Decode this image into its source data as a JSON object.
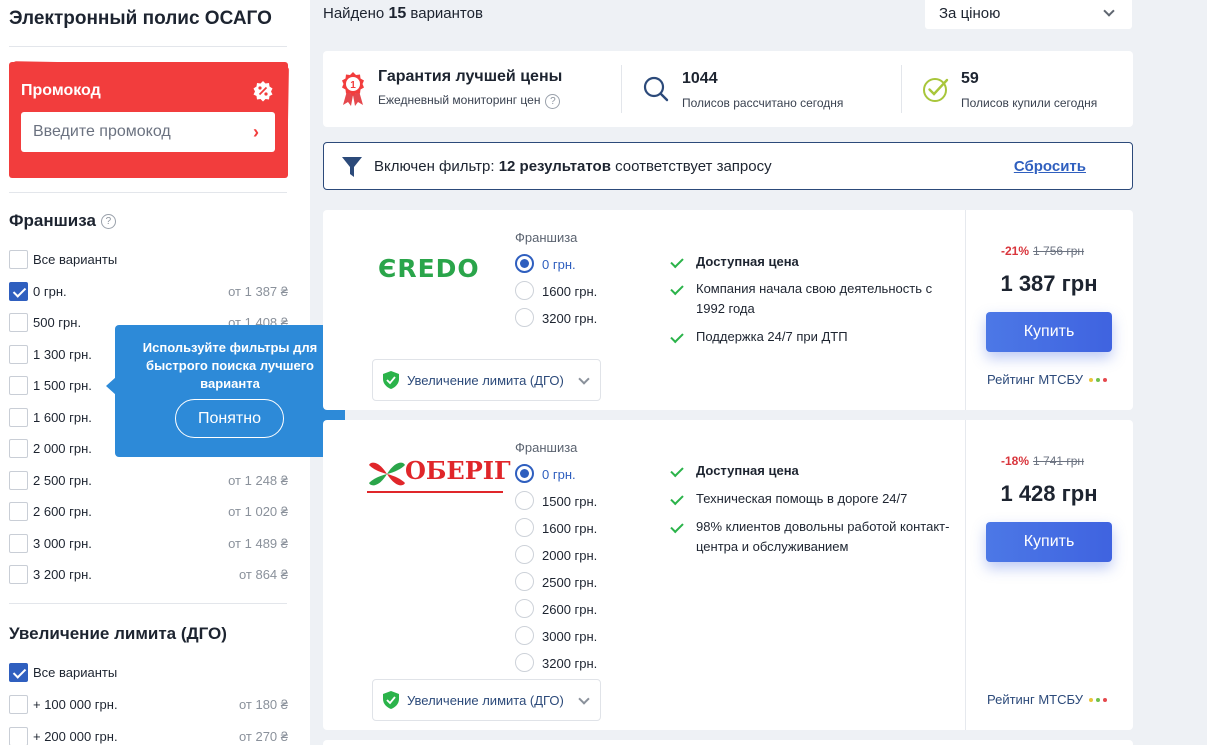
{
  "sidebar": {
    "title": "Электронный полис ОСАГО",
    "promo": {
      "title": "Промокод",
      "placeholder": "Введите промокод"
    },
    "franchise": {
      "title": "Франшиза",
      "items": [
        {
          "label": "Все варианты",
          "price": "",
          "checked": false
        },
        {
          "label": "0 грн.",
          "price": "от 1 387 ₴",
          "checked": true
        },
        {
          "label": "500 грн.",
          "price": "от 1 408 ₴",
          "checked": false
        },
        {
          "label": "1 300 грн.",
          "price": "",
          "checked": false
        },
        {
          "label": "1 500 грн.",
          "price": "",
          "checked": false
        },
        {
          "label": "1 600 грн.",
          "price": "",
          "checked": false
        },
        {
          "label": "2 000 грн.",
          "price": "",
          "checked": false
        },
        {
          "label": "2 500 грн.",
          "price": "от 1 248 ₴",
          "checked": false
        },
        {
          "label": "2 600 грн.",
          "price": "от 1 020 ₴",
          "checked": false
        },
        {
          "label": "3 000 грн.",
          "price": "от 1 489 ₴",
          "checked": false
        },
        {
          "label": "3 200 грн.",
          "price": "от 864 ₴",
          "checked": false
        }
      ]
    },
    "dgo": {
      "title": "Увеличение лимита (ДГО)",
      "items": [
        {
          "label": "Все варианты",
          "price": "",
          "checked": true
        },
        {
          "label": "+ 100 000 грн.",
          "price": "от 180 ₴",
          "checked": false
        },
        {
          "label": "+ 200 000 грн.",
          "price": "от 270 ₴",
          "checked": false
        }
      ]
    }
  },
  "tooltip": {
    "text": "Используйте фильтры для быстрого поиска лучшего варианта",
    "button": "Понятно",
    "close": "×"
  },
  "header": {
    "found_prefix": "Найдено",
    "found_count": "15",
    "found_suffix": "вариантов",
    "sort_label": "За ціною"
  },
  "stats": {
    "guarantee_title": "Гарантия лучшей цены",
    "guarantee_sub": "Ежедневный мониторинг цен",
    "calc_count": "1044",
    "calc_sub": "Полисов рассчитано сегодня",
    "bought_count": "59",
    "bought_sub": "Полисов купили сегодня",
    "badge_number": "1"
  },
  "filter": {
    "prefix": "Включен фильтр:",
    "results": "12 результатов",
    "suffix": "соответствует запросу",
    "reset": "Сбросить"
  },
  "offers": [
    {
      "logo_text": "ЄREDO",
      "franchise_title": "Франшиза",
      "franchise_options": [
        "0 грн.",
        "1600 грн.",
        "3200 грн."
      ],
      "dgo_label": "Увеличение лимита (ДГО)",
      "features": [
        "Доступная цена",
        "Компания начала свою деятельность с 1992 года",
        "Поддержка 24/7 при ДТП"
      ],
      "discount": "-21%",
      "old_price": "1 756 грн",
      "price": "1 387 грн",
      "buy_label": "Купить",
      "rating_label": "Рейтинг МТСБУ"
    },
    {
      "logo_text": "ОБЕРІГ",
      "franchise_title": "Франшиза",
      "franchise_options": [
        "0 грн.",
        "1500 грн.",
        "1600 грн.",
        "2000 грн.",
        "2500 грн.",
        "2600 грн.",
        "3000 грн.",
        "3200 грн."
      ],
      "dgo_label": "Увеличение лимита (ДГО)",
      "features": [
        "Доступная цена",
        "Техническая помощь в дороге 24/7",
        "98% клиентов довольны работой контакт-центра и обслуживанием"
      ],
      "discount": "-18%",
      "old_price": "1 741 грн",
      "price": "1 428 грн",
      "buy_label": "Купить",
      "rating_label": "Рейтинг МТСБУ"
    }
  ],
  "colors": {
    "accent": "#2f5fbf",
    "promo_red": "#f23d3d",
    "tooltip_blue": "#2d8ad8",
    "check_green": "#2bb34a",
    "discount_red": "#d9353c",
    "rating_dots": [
      "#e9c43a",
      "#6fc14b",
      "#e5484d"
    ]
  }
}
